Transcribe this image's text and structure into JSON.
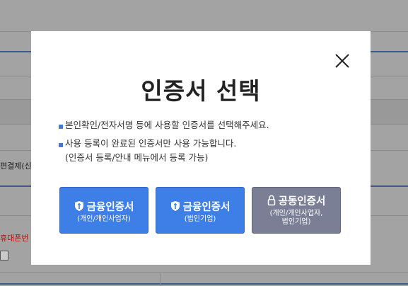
{
  "background": {
    "labels": {
      "payment": "편결제(신",
      "phone": "휴대폰번"
    }
  },
  "modal": {
    "title": "인증서 선택",
    "close_label": "close",
    "notes": [
      "본인확인/전자서명 등에 사용할 인증서를 선택해주세요.",
      "사용 등록이 완료된 인증서만 사용 가능합니다."
    ],
    "note_sub": "(인증서 등록/안내 메뉴에서 등록 가능)",
    "buttons": [
      {
        "title": "금융인증서",
        "subtitle": "(개인/개인사업자)",
        "icon": "shield-icon",
        "color": "#3d7fe6"
      },
      {
        "title": "금융인증서",
        "subtitle": "(법인기업)",
        "icon": "shield-icon",
        "color": "#3d7fe6"
      },
      {
        "title": "공동인증서",
        "subtitle_line1": "(개인/개인사업자,",
        "subtitle_line2": "법인기업)",
        "icon": "lock-icon",
        "color": "#7b7f95"
      }
    ]
  }
}
